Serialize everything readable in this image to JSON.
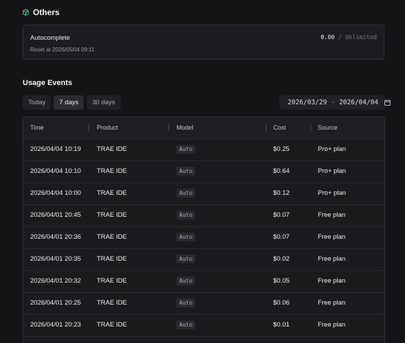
{
  "others": {
    "title": "Others",
    "icon": "cube-icon",
    "accent_color": "#3fcf8e",
    "item": {
      "name": "Autocomplete",
      "reset": "Reset at 2026/05/04 09:11",
      "used": "0.00",
      "separator": "/",
      "limit": "Unlimited"
    }
  },
  "usage_events": {
    "title": "Usage Events",
    "ranges": [
      {
        "label": "Today",
        "active": false
      },
      {
        "label": "7 days",
        "active": true
      },
      {
        "label": "30 days",
        "active": false
      }
    ],
    "date_range": {
      "start": "2026/03/29",
      "separator": "-",
      "end": "2026/04/04",
      "icon": "calendar-icon"
    },
    "table": {
      "columns": [
        "Time",
        "Product",
        "Model",
        "Cost",
        "Source"
      ],
      "rows": [
        {
          "time": "2026/04/04 10:19",
          "product": "TRAE IDE",
          "model": "Auto",
          "cost": "$0.25",
          "source": "Pro+ plan"
        },
        {
          "time": "2026/04/04 10:10",
          "product": "TRAE IDE",
          "model": "Auto",
          "cost": "$0.64",
          "source": "Pro+ plan"
        },
        {
          "time": "2026/04/04 10:00",
          "product": "TRAE IDE",
          "model": "Auto",
          "cost": "$0.12",
          "source": "Pro+ plan"
        },
        {
          "time": "2026/04/01 20:45",
          "product": "TRAE IDE",
          "model": "Auto",
          "cost": "$0.07",
          "source": "Free plan"
        },
        {
          "time": "2026/04/01 20:36",
          "product": "TRAE IDE",
          "model": "Auto",
          "cost": "$0.07",
          "source": "Free plan"
        },
        {
          "time": "2026/04/01 20:35",
          "product": "TRAE IDE",
          "model": "Auto",
          "cost": "$0.02",
          "source": "Free plan"
        },
        {
          "time": "2026/04/01 20:32",
          "product": "TRAE IDE",
          "model": "Auto",
          "cost": "$0.05",
          "source": "Free plan"
        },
        {
          "time": "2026/04/01 20:25",
          "product": "TRAE IDE",
          "model": "Auto",
          "cost": "$0.06",
          "source": "Free plan"
        },
        {
          "time": "2026/04/01 20:23",
          "product": "TRAE IDE",
          "model": "Auto",
          "cost": "$0.01",
          "source": "Free plan"
        }
      ]
    }
  }
}
